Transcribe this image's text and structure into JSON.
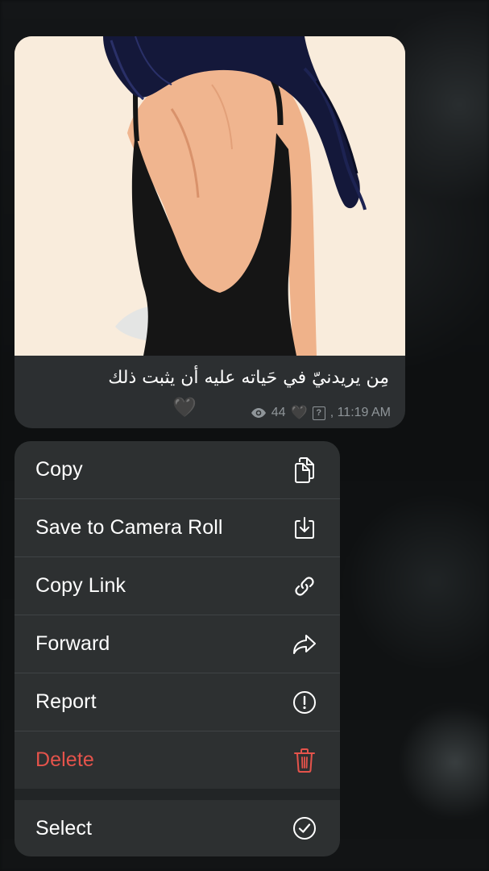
{
  "message": {
    "caption": "مِن يريدنيّ في حَياته عليه أن يثبت ذلك",
    "caption_emoji": "🖤",
    "views": "44",
    "meta_emoji": "🖤",
    "meta_unknown_glyph": "?",
    "time": ", 11:19 AM"
  },
  "menu": {
    "items": [
      {
        "label": "Copy",
        "icon": "copy-icon"
      },
      {
        "label": "Save to Camera Roll",
        "icon": "save-download-icon"
      },
      {
        "label": "Copy Link",
        "icon": "link-icon"
      },
      {
        "label": "Forward",
        "icon": "forward-arrow-icon"
      },
      {
        "label": "Report",
        "icon": "exclamation-circle-icon"
      },
      {
        "label": "Delete",
        "icon": "trash-icon",
        "color": "#e5534b"
      }
    ],
    "secondary": [
      {
        "label": "Select",
        "icon": "check-circle-icon"
      }
    ]
  },
  "colors": {
    "menu_bg": "#2d3031",
    "bubble_bg": "#2c2f31",
    "danger": "#e5534b",
    "meta_text": "#8f9599"
  }
}
